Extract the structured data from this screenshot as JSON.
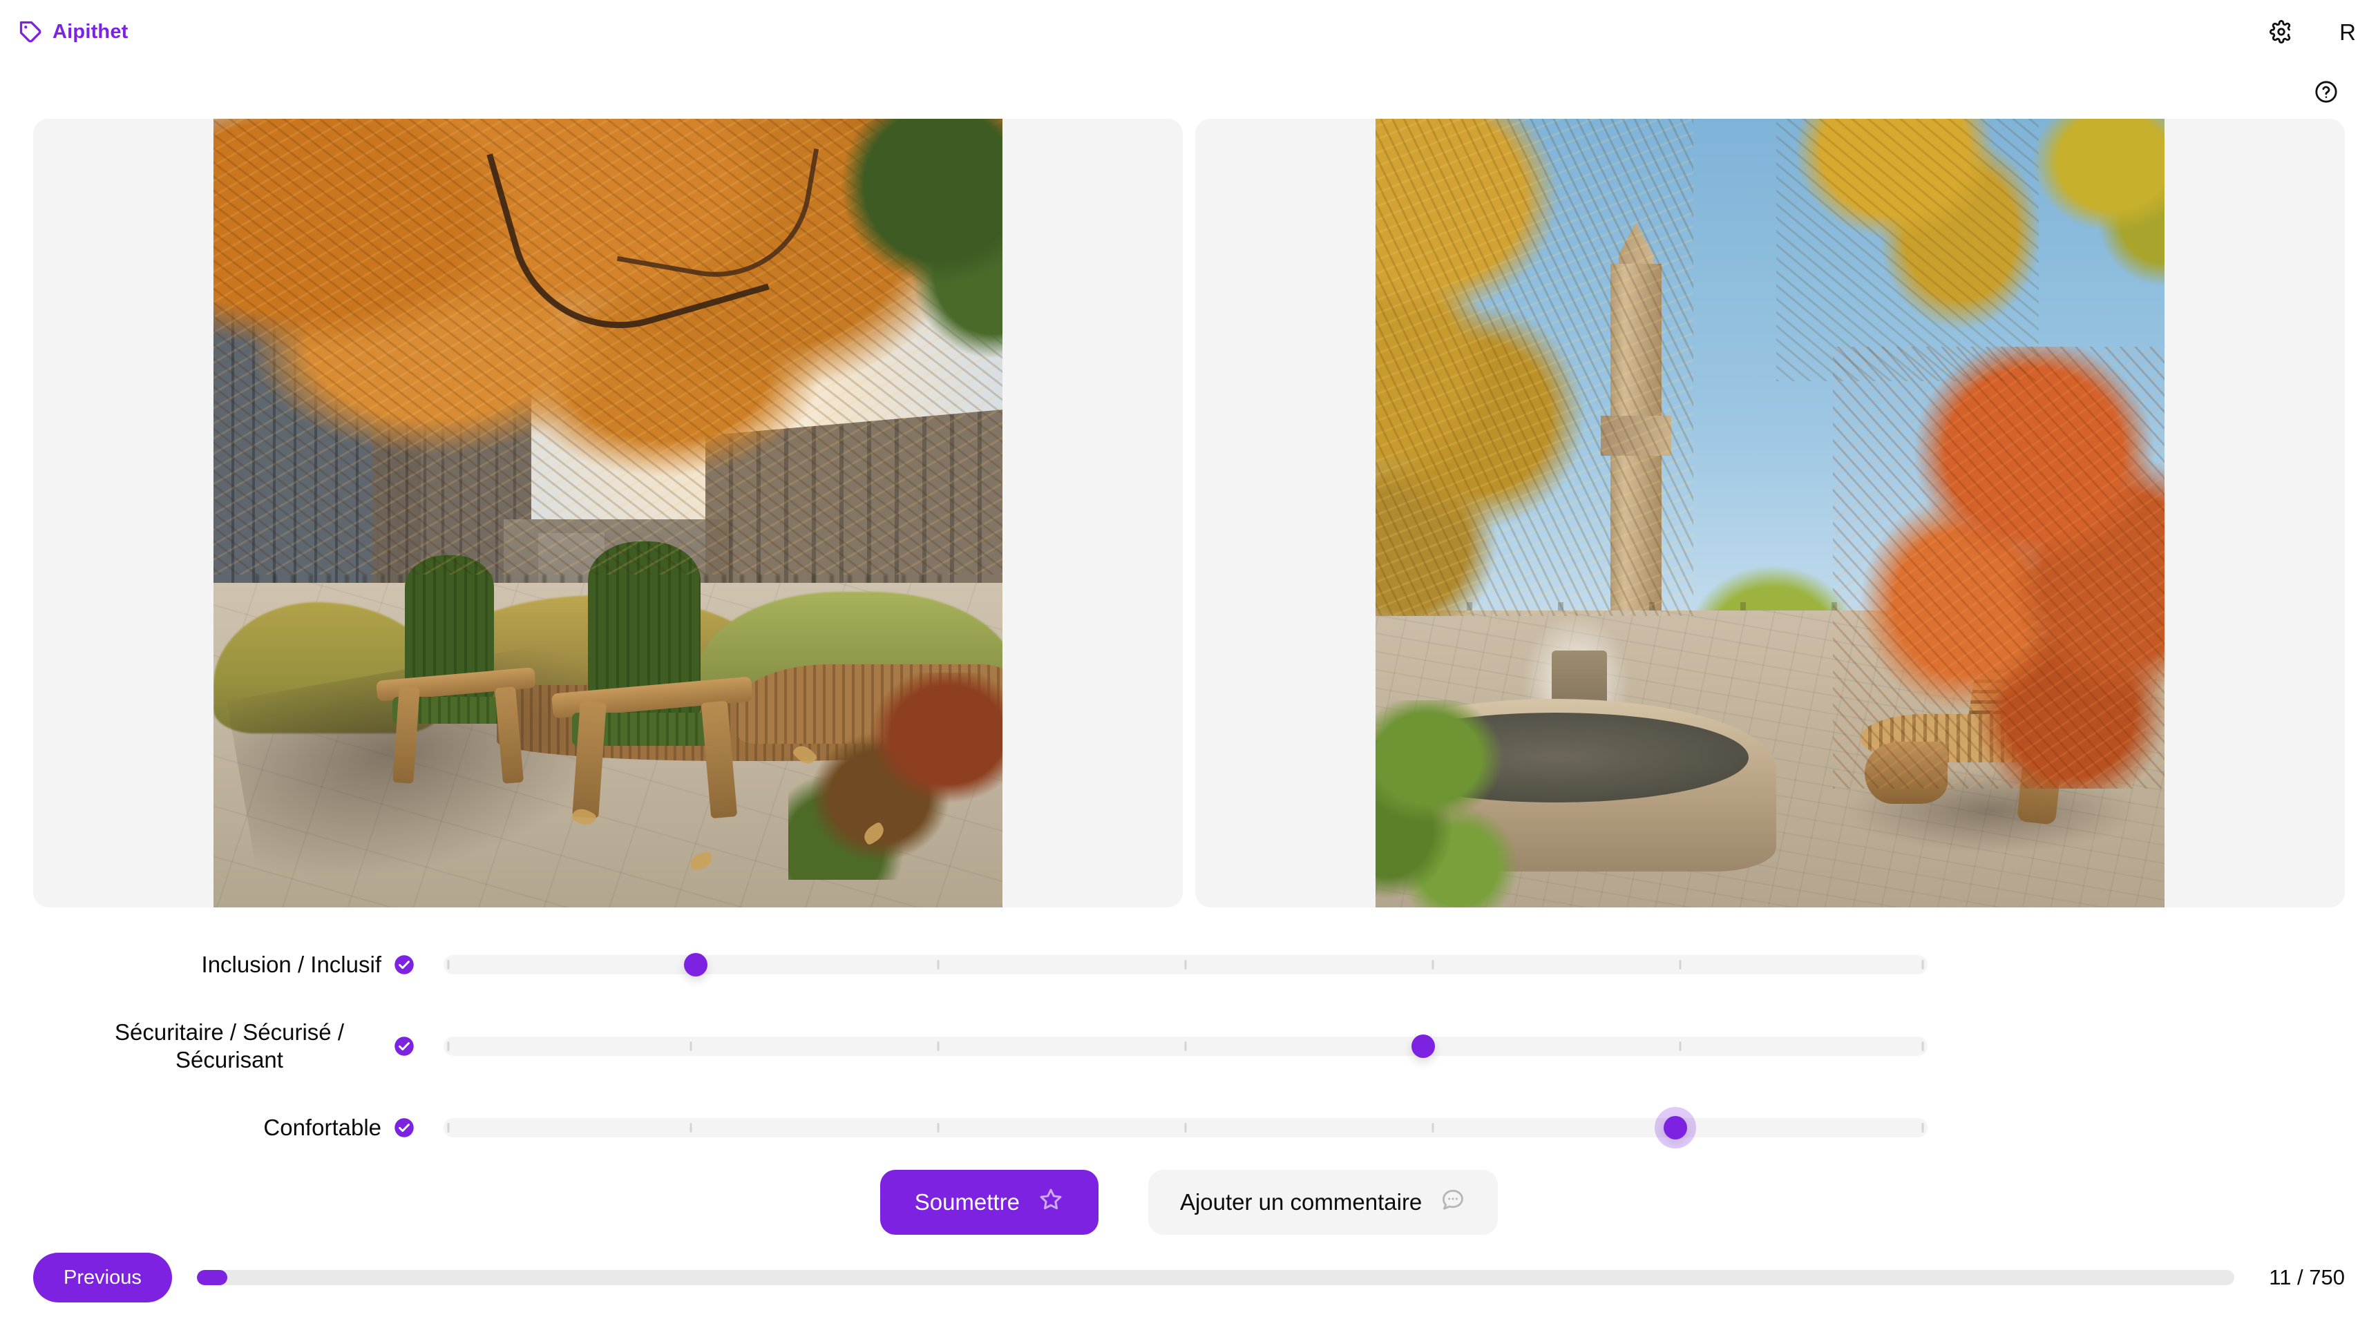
{
  "header": {
    "brand_name": "Aipithet",
    "brand_icon": "tag-icon",
    "settings_icon": "gear-icon",
    "avatar_initial": "R",
    "help_icon": "help-circle-icon",
    "accent_color": "#7c22e0"
  },
  "images": [
    {
      "alt": "Autumn urban plaza with glass buildings, fountain and two green wooden lounge chairs on paving"
    },
    {
      "alt": "Autumn campus plaza with stone clock tower, circular fountain and a wooden lounge chair"
    }
  ],
  "sliders": [
    {
      "label": "Inclusion / Inclusif",
      "validated": true,
      "badge_icon": "check-circle-icon",
      "value_percent": 17,
      "focused": false
    },
    {
      "label": "Sécuritaire / Sécurisé / Sécurisant",
      "validated": true,
      "badge_icon": "check-circle-icon",
      "value_percent": 66,
      "focused": false
    },
    {
      "label": "Confortable",
      "validated": true,
      "badge_icon": "check-circle-icon",
      "value_percent": 83,
      "focused": true
    }
  ],
  "slider_scale": {
    "tick_count": 7,
    "min": 0,
    "max": 100
  },
  "actions": {
    "submit_label": "Soumettre",
    "submit_icon": "star-outline-icon",
    "comment_label": "Ajouter un commentaire",
    "comment_icon": "chat-bubble-icon"
  },
  "footer": {
    "previous_label": "Previous",
    "progress_text": "11 / 750",
    "progress_percent": 1.5
  }
}
